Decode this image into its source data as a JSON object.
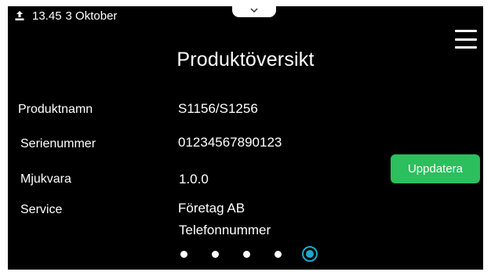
{
  "status_bar": {
    "time": "13.45",
    "date": "3 Oktober",
    "icon": "upload-icon"
  },
  "header": {
    "title": "Produktöversikt",
    "menu_icon": "hamburger-menu-icon",
    "pull_tab_icon": "chevron-down-icon"
  },
  "product_info": {
    "rows": [
      {
        "label": "Produktnamn",
        "values": [
          "S1156/S1256"
        ]
      },
      {
        "label": "Serienummer",
        "values": [
          "01234567890123"
        ]
      },
      {
        "label": "Mjukvara",
        "values": [
          "1.0.0"
        ]
      },
      {
        "label": "Service",
        "values": [
          "Företag AB",
          "Telefonnummer"
        ]
      }
    ]
  },
  "actions": {
    "update_label": "Uppdatera"
  },
  "pager": {
    "total": 5,
    "active_index": 4
  },
  "colors": {
    "background": "#000000",
    "update_button": "#2bbf5e",
    "pager_active": "#1fa8c9",
    "text": "#ffffff"
  }
}
